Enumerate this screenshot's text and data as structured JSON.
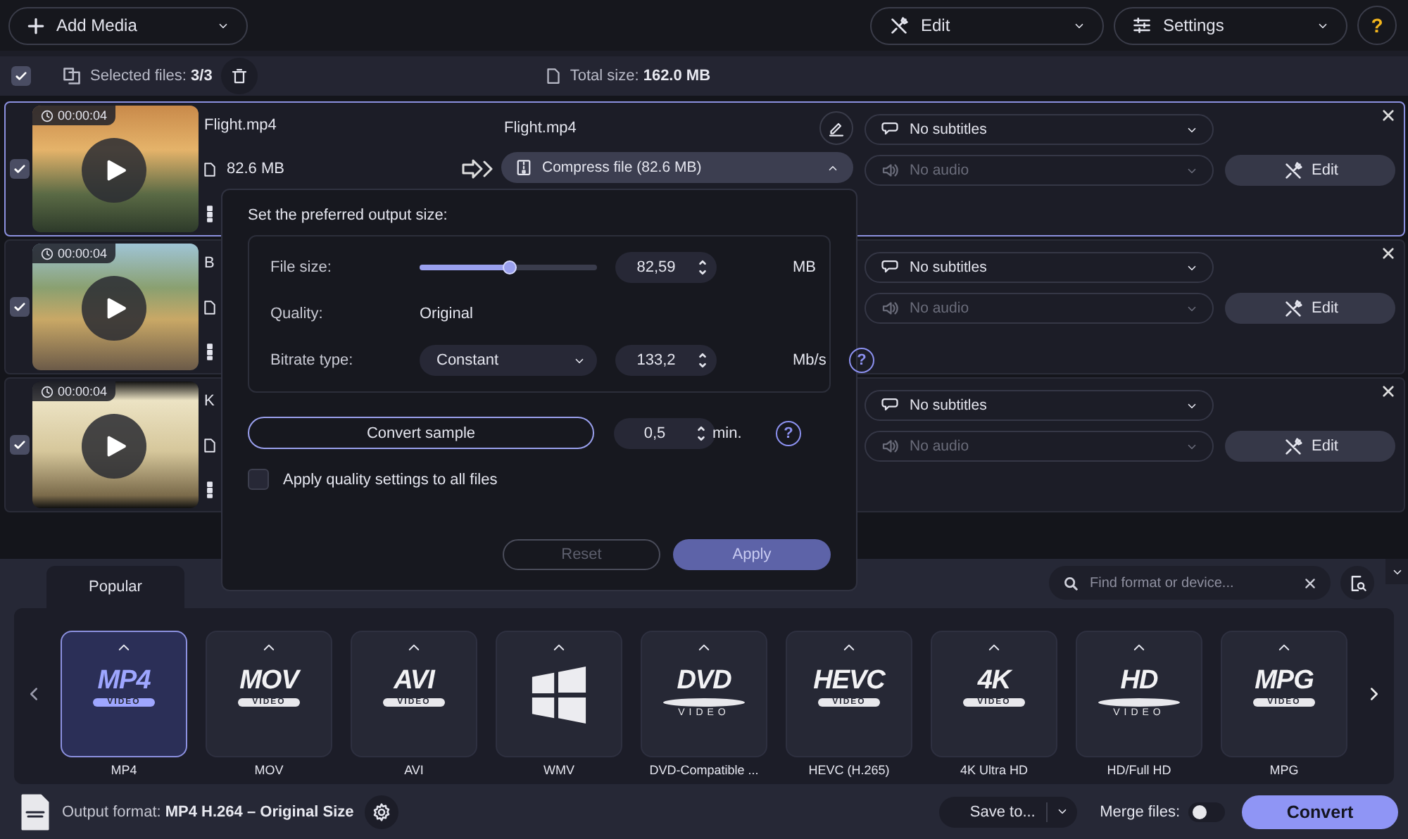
{
  "toolbar": {
    "add_media": "Add Media",
    "edit": "Edit",
    "settings": "Settings",
    "help": "?"
  },
  "selection_bar": {
    "checked": true,
    "selected_label": "Selected files:",
    "selected_value": "3/3",
    "total_label": "Total size:",
    "total_value": "162.0 MB"
  },
  "files": [
    {
      "selected": true,
      "checked": true,
      "duration": "00:00:04",
      "source_name": "Flight.mp4",
      "source_size": "82.6 MB",
      "output_name": "Flight.mp4",
      "compress": "Compress file (82.6 MB)",
      "compress_expanded": true,
      "subtitles": "No subtitles",
      "audio": "No audio",
      "audio_disabled": true,
      "edit": "Edit"
    },
    {
      "selected": false,
      "checked": true,
      "duration": "00:00:04",
      "source_name": "B",
      "subtitles": "No subtitles",
      "audio": "No audio",
      "audio_disabled": true,
      "edit": "Edit"
    },
    {
      "selected": false,
      "checked": true,
      "duration": "00:00:04",
      "source_name": "K",
      "subtitles": "No subtitles",
      "audio": "No audio",
      "audio_disabled": true,
      "edit": "Edit"
    }
  ],
  "compress_popup": {
    "title": "Set the preferred output size:",
    "file_size": {
      "label": "File size:",
      "level": 0.51,
      "value": "82,59",
      "unit": "MB"
    },
    "quality": {
      "label": "Quality:",
      "value": "Original"
    },
    "bitrate": {
      "label": "Bitrate type:",
      "type": "Constant",
      "value": "133,2",
      "unit": "Mb/s",
      "help": "?"
    },
    "sample": {
      "button": "Convert sample",
      "value": "0,5",
      "unit": "min.",
      "help": "?"
    },
    "apply_all": {
      "label": "Apply quality settings to all files",
      "checked": false
    },
    "reset": {
      "label": "Reset",
      "disabled": true
    },
    "apply": {
      "label": "Apply"
    }
  },
  "format_tabs": [
    {
      "label": "Popular",
      "selected": true
    }
  ],
  "format_search": {
    "placeholder": "Find format or device..."
  },
  "formats": [
    {
      "kind": "badge",
      "logo": "MP4",
      "sub": "VIDEO",
      "label": "MP4",
      "selected": true
    },
    {
      "kind": "badge",
      "logo": "MOV",
      "sub": "VIDEO",
      "label": "MOV",
      "selected": false
    },
    {
      "kind": "badge",
      "logo": "AVI",
      "sub": "VIDEO",
      "label": "AVI",
      "selected": false
    },
    {
      "kind": "windows",
      "label": "WMV",
      "selected": false
    },
    {
      "kind": "disc",
      "logo": "DVD",
      "sub": "VIDEO",
      "label": "DVD-Compatible ...",
      "selected": false
    },
    {
      "kind": "badge",
      "logo": "HEVC",
      "sub": "VIDEO",
      "label": "HEVC (H.265)",
      "selected": false
    },
    {
      "kind": "badge",
      "logo": "4K",
      "sub": "VIDEO",
      "label": "4K Ultra HD",
      "selected": false
    },
    {
      "kind": "disc",
      "logo": "HD",
      "sub": "VIDEO",
      "label": "HD/Full HD",
      "selected": false
    },
    {
      "kind": "badge",
      "logo": "MPG",
      "sub": "VIDEO",
      "label": "MPG",
      "selected": false
    }
  ],
  "footer": {
    "output_label": "Output format:",
    "output_value": "MP4 H.264 – Original Size",
    "save_to": "Save to...",
    "merge": {
      "label": "Merge files:",
      "on": false
    },
    "convert": "Convert"
  }
}
